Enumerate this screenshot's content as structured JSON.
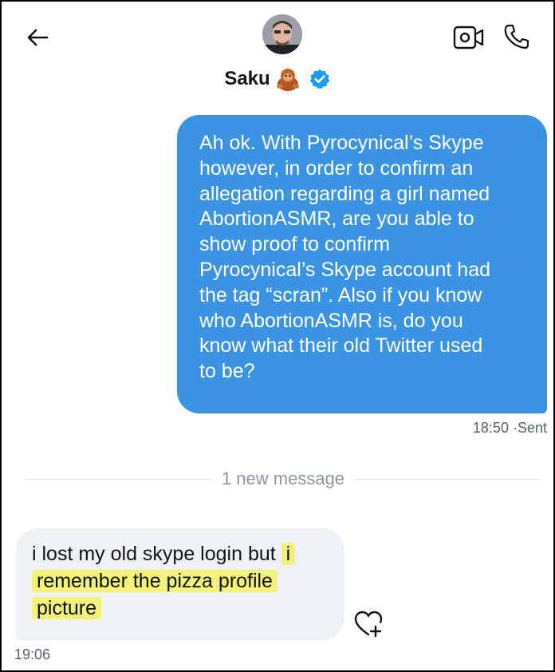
{
  "header": {
    "contact_name": "Saku",
    "verified": true
  },
  "messages": {
    "sent": {
      "lines": [
        "Ah ok. With Pyrocynical’s Skype",
        "however, in order to confirm an",
        "allegation regarding a girl named",
        "AbortionASMR, are you able to",
        "show proof to confirm",
        "Pyrocynical’s Skype account had",
        "the tag “scran”. Also if you know",
        "who AbortionASMR is, do you",
        "know what their old Twitter used",
        "to be?"
      ],
      "time": "18:50",
      "status": "·Sent"
    },
    "divider_label": "1 new message",
    "received": {
      "line1_plain": "i lost my old skype login but",
      "line1_highlight": "i",
      "line2_highlight": "remember the pizza profile",
      "line3_highlight": "picture",
      "time": "19:06"
    }
  },
  "icons": {
    "back": "arrow-left-icon",
    "video": "video-camera-icon",
    "call": "phone-icon",
    "verified": "verified-badge-icon",
    "emoji": "orangutan-emoji-icon",
    "react": "heart-plus-icon"
  },
  "colors": {
    "sent_bubble": "#3b93e4",
    "received_bubble": "#eef2f4",
    "highlight": "#f2f278",
    "verified": "#1d9bf0",
    "meta_text": "#536471"
  }
}
